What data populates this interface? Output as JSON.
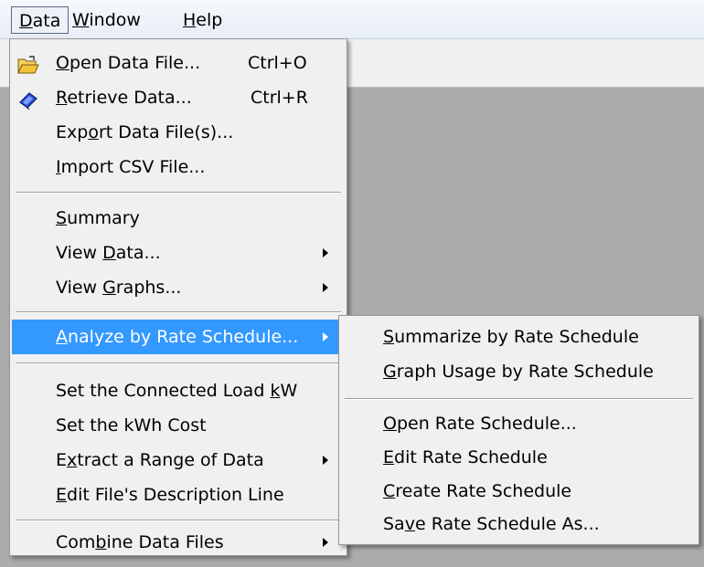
{
  "menubar": {
    "items": [
      {
        "pre": "",
        "key": "D",
        "post": "ata"
      },
      {
        "pre": "",
        "key": "W",
        "post": "indow"
      },
      {
        "pre": "",
        "key": "H",
        "post": "elp"
      }
    ]
  },
  "data_menu": {
    "items": [
      {
        "pre": "",
        "key": "O",
        "post": "pen Data File...",
        "shortcut": "Ctrl+O",
        "icon": "open-folder-icon"
      },
      {
        "pre": "",
        "key": "R",
        "post": "etrieve Data...",
        "shortcut": "Ctrl+R",
        "icon": "retrieve-data-icon"
      },
      {
        "pre": "Exp",
        "key": "o",
        "post": "rt Data File(s)..."
      },
      {
        "pre": "",
        "key": "I",
        "post": "mport CSV File..."
      },
      {
        "pre": "",
        "key": "S",
        "post": "ummary"
      },
      {
        "pre": "View ",
        "key": "D",
        "post": "ata...",
        "submenu": true
      },
      {
        "pre": "View ",
        "key": "G",
        "post": "raphs...",
        "submenu": true
      },
      {
        "pre": "",
        "key": "A",
        "post": "nalyze by Rate Schedule...",
        "submenu": true,
        "highlighted": true
      },
      {
        "pre": "Set the Connected Load ",
        "key": "k",
        "post": "W"
      },
      {
        "pre": "Set the kWh Cost",
        "key": "",
        "post": ""
      },
      {
        "pre": "E",
        "key": "x",
        "post": "tract a Range of Data",
        "submenu": true
      },
      {
        "pre": "",
        "key": "E",
        "post": "dit File's Description Line"
      },
      {
        "pre": "Com",
        "key": "b",
        "post": "ine Data Files",
        "submenu": true
      }
    ]
  },
  "rate_submenu": {
    "items": [
      {
        "pre": "",
        "key": "S",
        "post": "ummarize by Rate Schedule"
      },
      {
        "pre": "",
        "key": "G",
        "post": "raph Usage by Rate Schedule"
      },
      {
        "pre": "",
        "key": "O",
        "post": "pen Rate Schedule..."
      },
      {
        "pre": "",
        "key": "E",
        "post": "dit Rate Schedule"
      },
      {
        "pre": "",
        "key": "C",
        "post": "reate Rate Schedule"
      },
      {
        "pre": "Sa",
        "key": "v",
        "post": "e Rate Schedule As..."
      }
    ]
  },
  "colors": {
    "highlight": "#3399ff",
    "workspace": "#ababab",
    "menu_bg": "#f0f0f0"
  }
}
